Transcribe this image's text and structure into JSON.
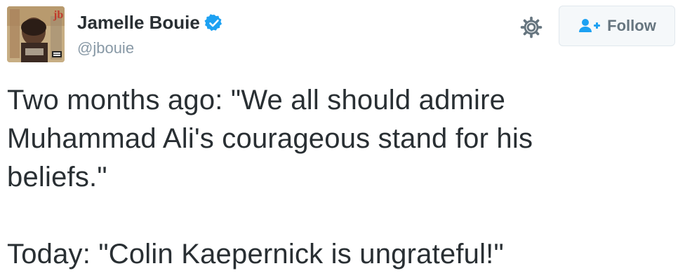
{
  "author": {
    "name": "Jamelle Bouie",
    "handle": "@jbouie",
    "verified": true,
    "avatar_icon": "profile-photo-album-art"
  },
  "actions": {
    "settings_icon": "gear-icon",
    "follow_label": "Follow",
    "follow_icon": "add-user-icon"
  },
  "tweet": {
    "lines": [
      "Two months ago: \"We all should admire",
      "Muhammad Ali's courageous stand for his",
      "beliefs.\"",
      "Today: \"Colin Kaepernick is ungrateful!\""
    ]
  },
  "colors": {
    "text": "#292f33",
    "handle": "#8899a6",
    "verified_badge": "#1da1f2",
    "follow_icon": "#1da1f2",
    "button_text": "#66757f",
    "button_bg": "#f5f8fa",
    "gear": "#66757f"
  }
}
